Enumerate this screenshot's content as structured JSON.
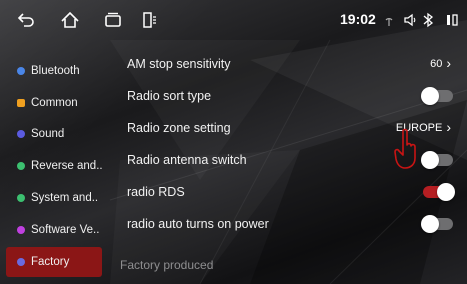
{
  "status_bar": {
    "time": "19:02",
    "icons": [
      "back-icon",
      "home-icon",
      "recent-apps-icon",
      "split-screen-icon",
      "signal-icon",
      "volume-icon",
      "bluetooth-icon",
      "battery-icon"
    ]
  },
  "sidebar": {
    "items": [
      {
        "label": "Bluetooth",
        "color": "#4a86e8"
      },
      {
        "label": "Common",
        "color": "#f0a020"
      },
      {
        "label": "Sound",
        "color": "#5b5be0"
      },
      {
        "label": "Reverse and..",
        "color": "#3cc070"
      },
      {
        "label": "System and..",
        "color": "#3cc070"
      },
      {
        "label": "Software Ve..",
        "color": "#c040e0"
      },
      {
        "label": "Factory",
        "color": "#6a6ae0"
      }
    ],
    "active_index": 6,
    "active_color": "#8b1616"
  },
  "settings": {
    "rows": [
      {
        "label": "AM stop sensitivity",
        "type": "value",
        "value": "60"
      },
      {
        "label": "Radio sort type",
        "type": "toggle",
        "on": false
      },
      {
        "label": "Radio zone setting",
        "type": "value",
        "value": "EUROPE"
      },
      {
        "label": "Radio antenna switch",
        "type": "toggle",
        "on": false
      },
      {
        "label": "radio RDS",
        "type": "toggle",
        "on": true
      },
      {
        "label": "radio auto turns on power",
        "type": "toggle",
        "on": false
      }
    ],
    "footer": "Factory produced"
  },
  "colors": {
    "toggle_on": "#b51e22",
    "toggle_off": "#6e6e70",
    "cursor": "#c81414"
  }
}
